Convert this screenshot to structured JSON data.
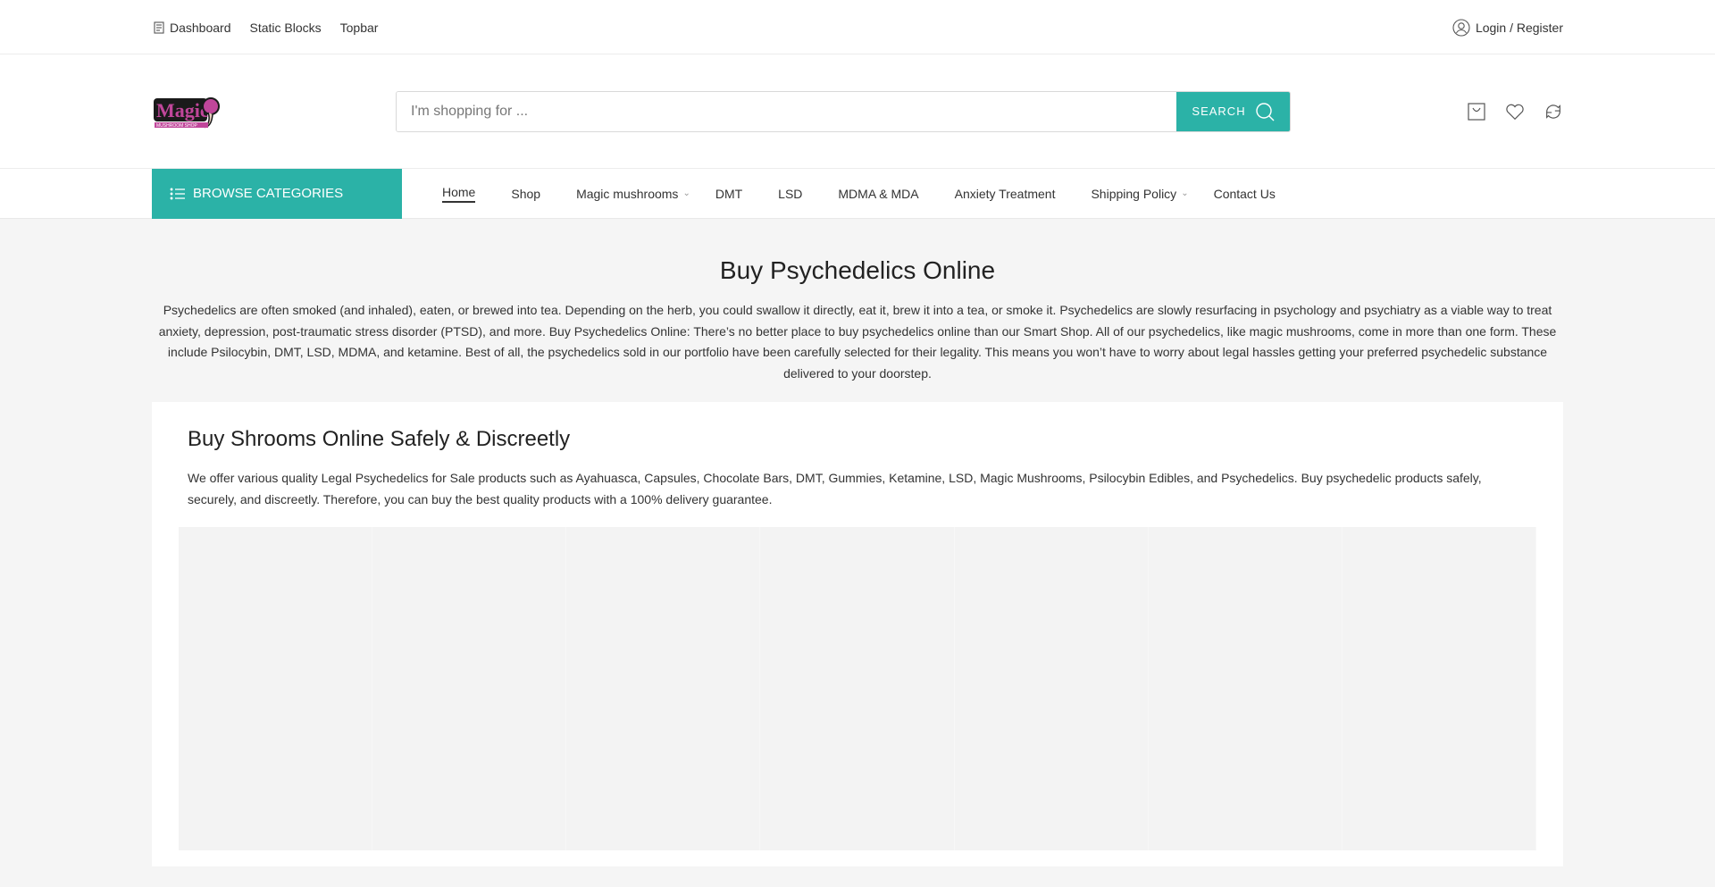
{
  "topbar": {
    "links": [
      "Dashboard",
      "Static Blocks",
      "Topbar"
    ],
    "login": "Login / Register"
  },
  "header": {
    "logo_text": "Magic",
    "logo_sub": "MUSHROOM SHOP",
    "search_placeholder": "I'm shopping for ...",
    "search_button": "SEARCH"
  },
  "nav": {
    "browse": "BROWSE CATEGORIES",
    "items": [
      {
        "label": "Home"
      },
      {
        "label": "Shop"
      },
      {
        "label": "Magic mushrooms"
      },
      {
        "label": "DMT"
      },
      {
        "label": "LSD"
      },
      {
        "label": "MDMA & MDA"
      },
      {
        "label": "Anxiety Treatment"
      },
      {
        "label": "Shipping Policy"
      },
      {
        "label": "Contact Us"
      }
    ]
  },
  "main": {
    "title": "Buy Psychedelics Online",
    "intro": "Psychedelics are often smoked (and inhaled), eaten, or brewed into tea. Depending on the herb, you could swallow it directly, eat it, brew it into a tea, or smoke it. Psychedelics are slowly resurfacing in psychology and psychiatry as a viable way to treat anxiety, depression, post-traumatic stress disorder (PTSD), and more. Buy Psychedelics Online: There’s no better place to buy psychedelics online than our Smart Shop. All of our psychedelics, like magic mushrooms, come in more than one form. These include Psilocybin, DMT, LSD, MDMA, and ketamine. Best of all, the psychedelics sold in our portfolio have been carefully selected for their legality. This means you won’t have to worry about legal hassles getting your preferred psychedelic substance delivered to your doorstep.",
    "card_title": "Buy Shrooms Online Safely & Discreetly",
    "card_text": "We offer various quality Legal Psychedelics for Sale products such as Ayahuasca, Capsules, Chocolate Bars, DMT, Gummies, Ketamine, LSD, Magic Mushrooms, Psilocybin Edibles, and Psychedelics. Buy psychedelic products safely, securely, and discreetly. Therefore, you can buy the best quality products with a 100% delivery guarantee."
  },
  "colors": {
    "accent": "#2bb2a7"
  }
}
